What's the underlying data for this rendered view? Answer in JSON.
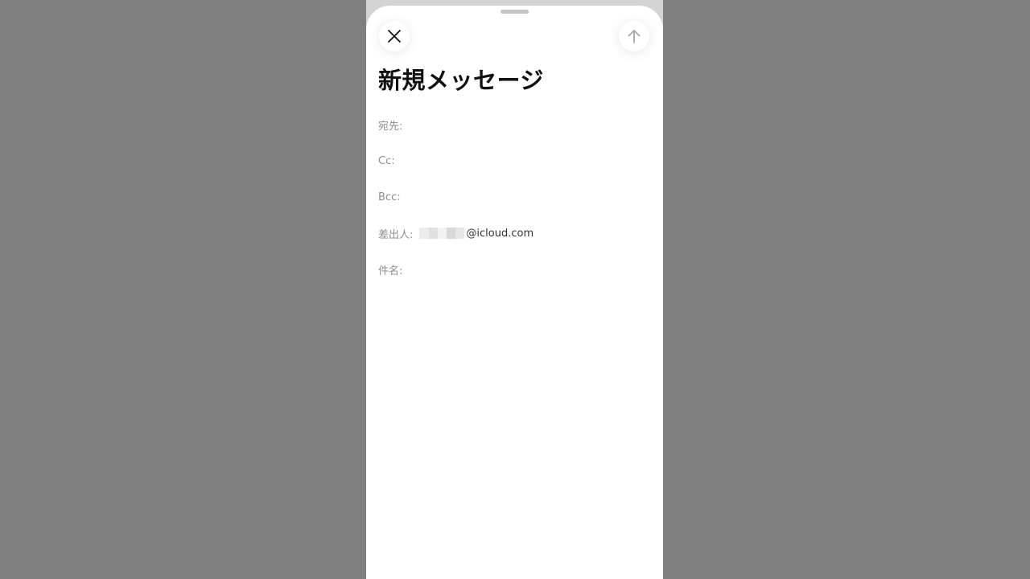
{
  "compose": {
    "title": "新規メッセージ",
    "to_label": "宛先:",
    "cc_label": "Cc:",
    "bcc_label": "Bcc:",
    "from_label": "差出人:",
    "from_domain": "@icloud.com",
    "subject_label": "件名:"
  },
  "icons": {
    "close": "close-icon",
    "send": "arrow-up-icon"
  },
  "colors": {
    "background": "#808080",
    "sheet": "#ffffff",
    "label": "#8e8e93",
    "title": "#111111"
  }
}
